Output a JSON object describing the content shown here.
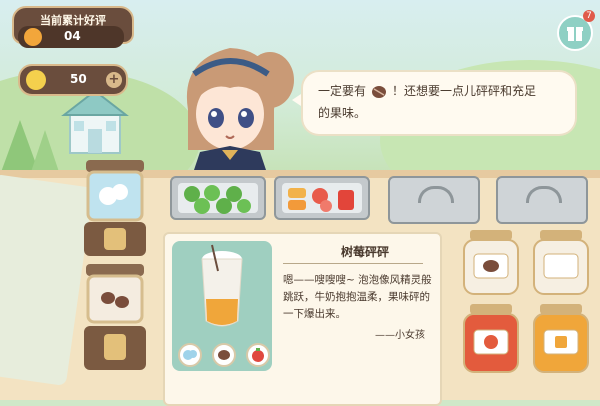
{
  "hud": {
    "praise_title": "当前累计好评",
    "praise_count": "04",
    "coins": "50",
    "coin_plus": "+",
    "gift_badge": "7"
  },
  "dialogue": {
    "line1_before": "一定要有",
    "line1_after": "！还想要一点儿砰砰和充足",
    "line2": "的果味。",
    "inline_icon": "coffee-bean-icon"
  },
  "recipe_card": {
    "title": "树莓砰砰",
    "description": "嗯——嗖嗖嗖~ 泡泡像风精灵般跳跃，牛奶抱抱温柔，果味砰的一下爆出来。",
    "signature": "——小女孩",
    "ingredients": [
      "milk-icon",
      "coffee-bean-icon",
      "raspberry-icon"
    ]
  },
  "colors": {
    "panel_brown": "#6a4d3d",
    "panel_border": "#d9b98b",
    "milk_jar": "#bfe3ef",
    "strawberry_jam": "#e35b3d",
    "honey_jam": "#f0a63a"
  }
}
